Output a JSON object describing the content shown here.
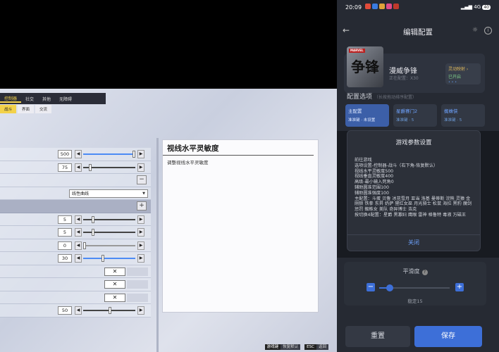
{
  "game": {
    "top_tabs": [
      "控制器",
      "社交",
      "其他",
      "无障碍"
    ],
    "active_tab": "控制器",
    "sub_tabs": [
      "战斗",
      "界面",
      "交流"
    ],
    "active_sub_tab": "战斗",
    "rows": {
      "r0_value": "500",
      "r1_value": "75",
      "curve_option": "线性曲线",
      "r5_value": "5",
      "r6_value": "5",
      "r7_value": "0",
      "r8_value": "30",
      "x_glyph": "✕",
      "minus_glyph": "−",
      "plus_glyph": "+",
      "left_arrow": "◀",
      "right_arrow": "▶",
      "r12_value": "50"
    },
    "info_panel": {
      "title": "视线水平灵敏度",
      "description": "调整视线水平灵敏度"
    },
    "bottom_hints": [
      {
        "key": "游戏键",
        "label": "恢复默认"
      },
      {
        "key": "ESC",
        "label": "返回"
      }
    ]
  },
  "phone": {
    "status": {
      "time": "20:09",
      "right": "4G",
      "battery": "40"
    },
    "nav": {
      "title": "编辑配置",
      "back_glyph": "←",
      "info_glyph": "i"
    },
    "game_card": {
      "name": "漫威争锋",
      "subtitle": "正在配置：X30",
      "cover_text": "争锋",
      "badge": "MARVEL",
      "mode_label": "灵动映射 ›",
      "mode_status": "已开启",
      "dots": "• • •"
    },
    "section": {
      "title": "配置选项",
      "hint": "（长按拖动排序配置）"
    },
    "config_tabs": [
      {
        "name": "主配置",
        "sub": "准准键 · 未设置"
      },
      {
        "name": "星爵赛门2",
        "sub": "准准键 · 5"
      },
      {
        "name": "蜘蛛侠",
        "sub": "准准键 · 5"
      }
    ],
    "dialog": {
      "title": "游戏参数设置",
      "lines": [
        "前往游戏",
        "选项设置-控制器-战斗（右下角-恢复默认）",
        "视线水平灵敏度500",
        "视线垂直灵敏度400",
        "高级-最小输入死角0",
        "辅助圆准范围100",
        "辅助圆准强度100",
        "主配置：斗蛋 贝鲁 冰花雪月 亚当 洛基 曼蒂斯 浣熊 灵猿 金刚狼 铁拳 东昇 奶萨 猩红女巫 月光骑士 松鼠 海拉 黑豹 魔剑 惩罚 蜘蛛女 美队 奇异博士 浩克",
        "按切换4配置：星爵 黑寡妇 鹰眼 雷神 格鲁特 毒液 万磁王"
      ],
      "close_label": "关闭"
    },
    "smoothing": {
      "label": "平滑度",
      "value_text": "稳定15",
      "value": 15,
      "max": 100,
      "minus": "−",
      "plus": "+",
      "help": "?"
    },
    "footer": {
      "reset": "重置",
      "save": "保存"
    }
  }
}
